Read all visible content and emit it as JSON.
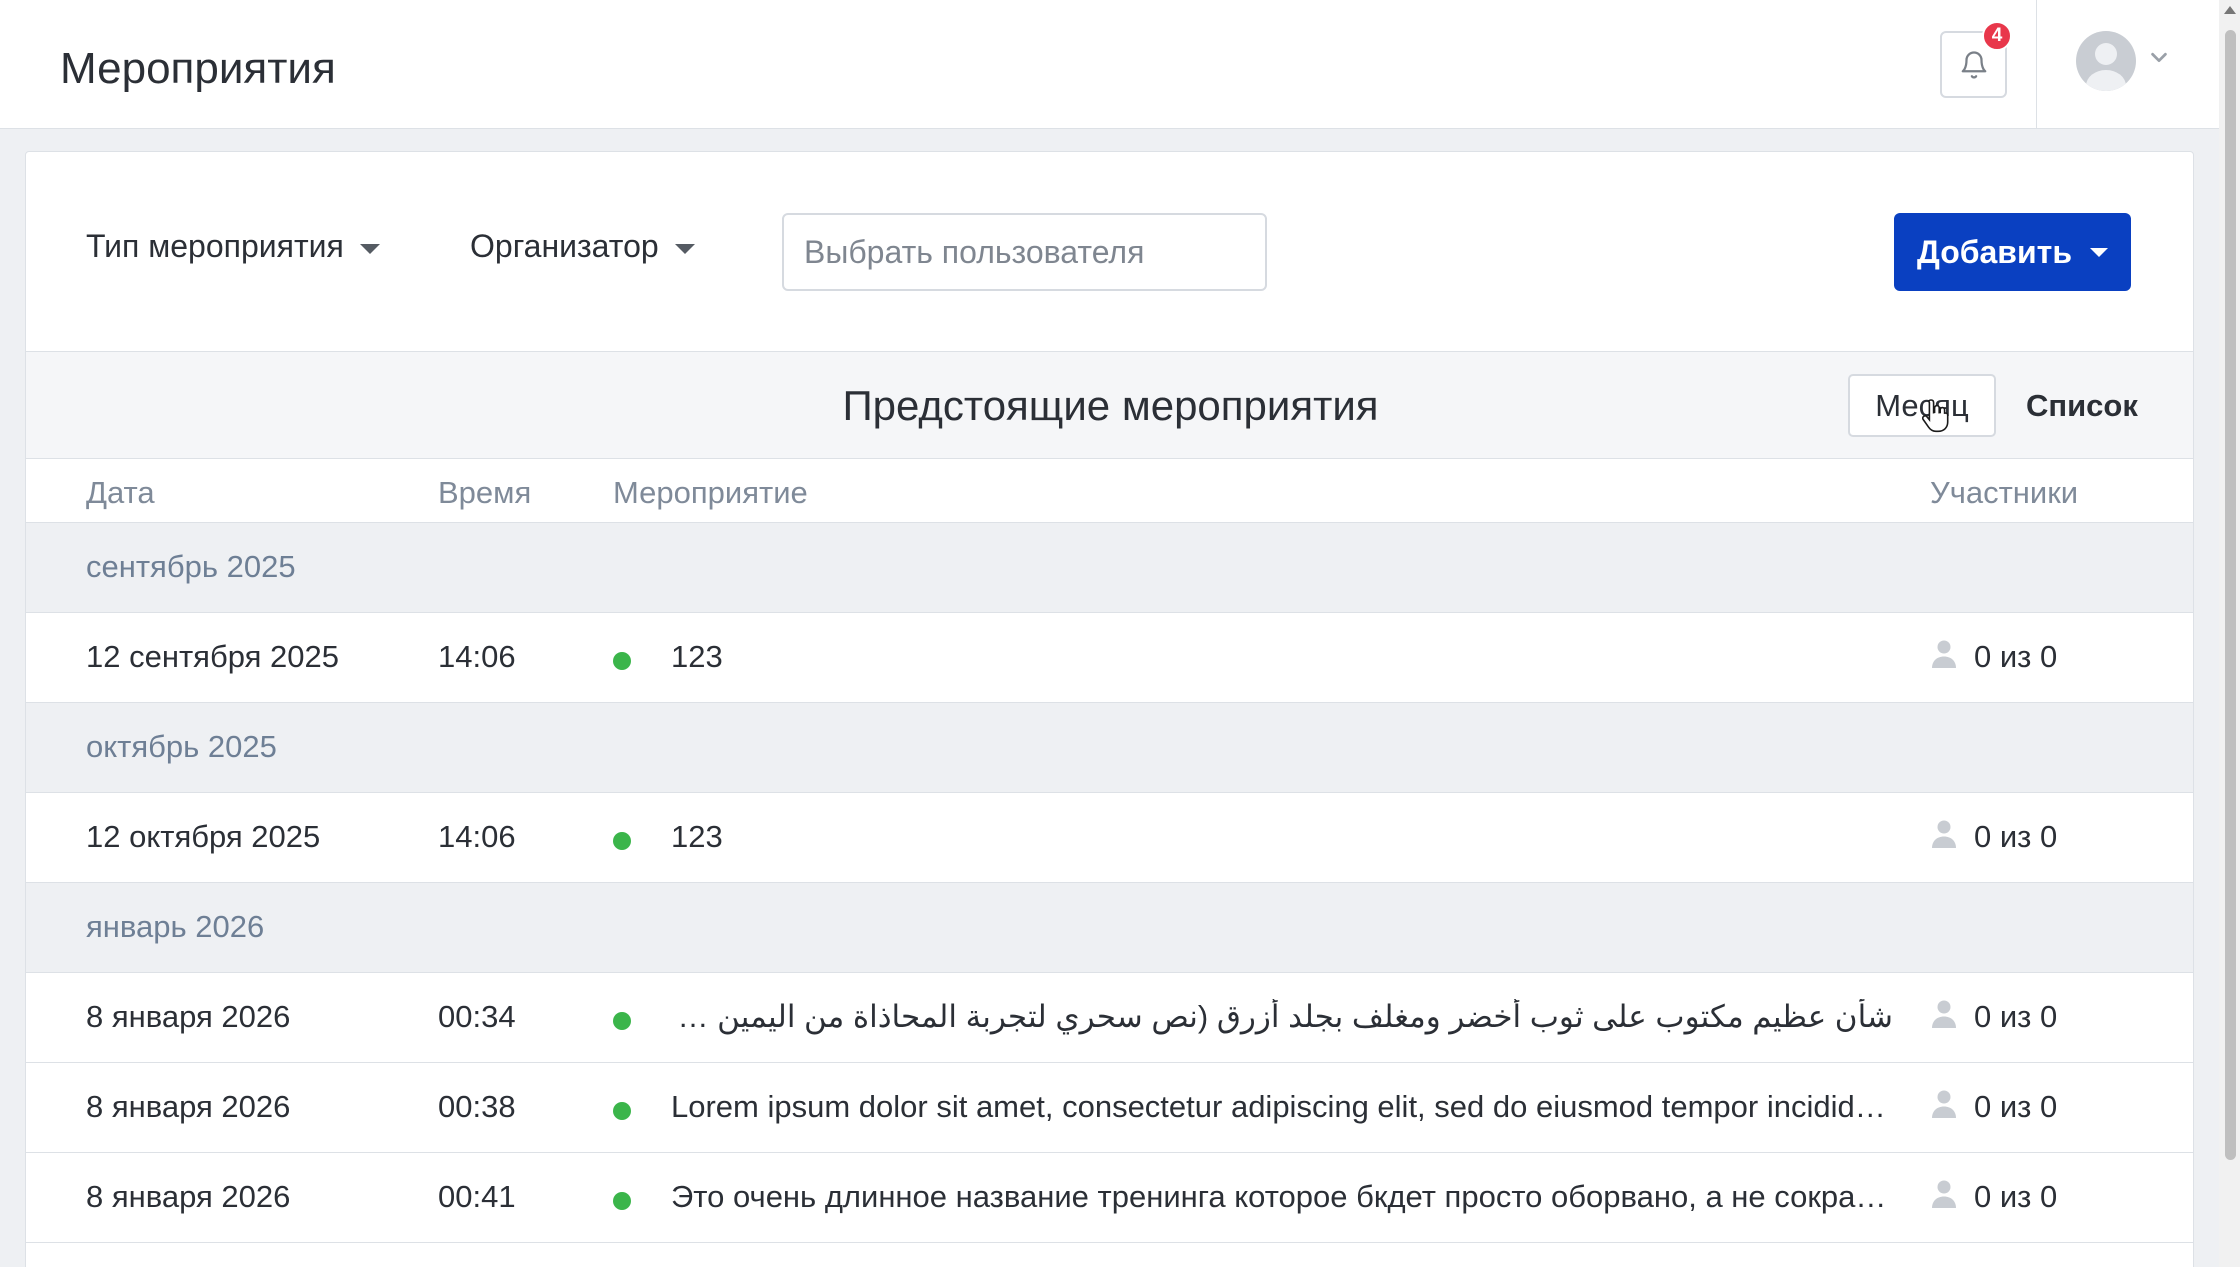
{
  "header": {
    "title": "Мероприятия",
    "notifications_count": "4",
    "bell_icon": "bell-icon",
    "avatar_icon": "user-avatar-icon"
  },
  "filters": {
    "event_type_label": "Тип мероприятия",
    "organizer_label": "Организатор",
    "user_placeholder": "Выбрать пользователя",
    "add_button_label": "Добавить"
  },
  "subheader": {
    "title": "Предстоящие мероприятия",
    "view_month_label": "Месяц",
    "view_list_label": "Список"
  },
  "table": {
    "columns": [
      "Дата",
      "Время",
      "Мероприятие",
      "Участники"
    ],
    "groups": [
      {
        "month": "сентябрь 2025",
        "events": [
          {
            "date": "12 сентября 2025",
            "time": "14:06",
            "name": "123",
            "participants": "0 из 0"
          }
        ]
      },
      {
        "month": "октябрь 2025",
        "events": [
          {
            "date": "12 октября 2025",
            "time": "14:06",
            "name": "123",
            "participants": "0 из 0"
          }
        ]
      },
      {
        "month": "январь 2026",
        "events": [
          {
            "date": "8 января 2026",
            "time": "00:34",
            "name": "شأن عظيم مكتوب على ثوب أخضر ومغلف بجلد أزرق (نص سحري لتجربة المحاذاة من اليمين لليسار",
            "participants": "0 из 0"
          },
          {
            "date": "8 января 2026",
            "time": "00:38",
            "name": "Lorem ipsum dolor sit amet, consectetur adipiscing elit, sed do eiusmod tempor incididunt ut labore",
            "participants": "0 из 0"
          },
          {
            "date": "8 января 2026",
            "time": "00:41",
            "name": "Это очень длинное название тренинга которое бкдет просто оборвано, а не сокращено",
            "participants": "0 из 0"
          }
        ]
      }
    ]
  },
  "colors": {
    "accent": "#0a40c1",
    "badge": "#e8374b",
    "status_dot": "#3bb54a"
  }
}
